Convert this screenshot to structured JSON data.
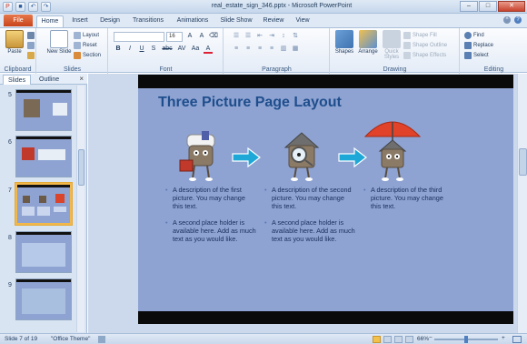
{
  "window": {
    "title": "real_estate_sign_346.pptx - Microsoft PowerPoint",
    "minimize": "–",
    "maximize": "□",
    "close": "✕"
  },
  "tabs": {
    "file": "File",
    "items": [
      "Home",
      "Insert",
      "Design",
      "Transitions",
      "Animations",
      "Slide Show",
      "Review",
      "View"
    ],
    "active": "Home"
  },
  "ribbon": {
    "clipboard": {
      "paste": "Paste",
      "label": "Clipboard"
    },
    "slides": {
      "new_slide": "New Slide",
      "layout": "Layout",
      "reset": "Reset",
      "section": "Section",
      "label": "Slides"
    },
    "font": {
      "size": "16",
      "label": "Font",
      "bold": "B",
      "italic": "I",
      "underline": "U",
      "shadow": "S",
      "strike": "abc",
      "spacing": "AV",
      "case": "Aa",
      "color": "A"
    },
    "paragraph": {
      "label": "Paragraph"
    },
    "drawing": {
      "shapes": "Shapes",
      "arrange": "Arrange",
      "quick_styles": "Quick Styles",
      "shape_fill": "Shape Fill",
      "shape_outline": "Shape Outline",
      "shape_effects": "Shape Effects",
      "label": "Drawing"
    },
    "editing": {
      "find": "Find",
      "replace": "Replace",
      "select": "Select",
      "label": "Editing"
    }
  },
  "left_panel": {
    "tabs": [
      "Slides",
      "Outline"
    ],
    "close": "×",
    "thumbnails": [
      {
        "num": "5"
      },
      {
        "num": "6"
      },
      {
        "num": "7",
        "selected": true
      },
      {
        "num": "8"
      },
      {
        "num": "9"
      }
    ]
  },
  "slide": {
    "title": "Three Picture Page Layout",
    "columns": [
      {
        "b1": "A description of the first picture.  You may change this text.",
        "b2": "A second place holder is available here.  Add as much text as you would like."
      },
      {
        "b1": "A description of the second picture.  You may change this text.",
        "b2": "A second place holder is available here.  Add as much text as you would like."
      },
      {
        "b1": "A description of the third picture.  You may change this text.",
        "b2": ""
      }
    ],
    "colors": {
      "background": "#8ea3d2",
      "title": "#1f4e8c",
      "arrow": "#1ea8d8"
    }
  },
  "status": {
    "slide_info": "Slide 7 of 19",
    "theme": "\"Office Theme\"",
    "zoom": "66%"
  }
}
